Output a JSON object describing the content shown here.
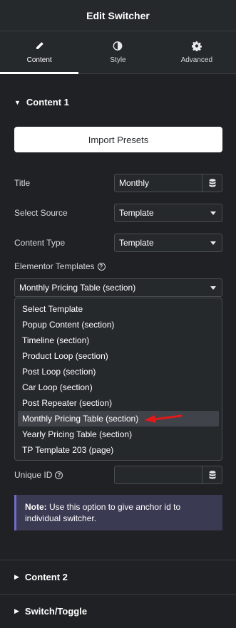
{
  "header": {
    "title": "Edit Switcher"
  },
  "tabs": [
    {
      "label": "Content",
      "icon": "pencil-icon",
      "active": true
    },
    {
      "label": "Style",
      "icon": "half-circle-icon",
      "active": false
    },
    {
      "label": "Advanced",
      "icon": "gear-icon",
      "active": false
    }
  ],
  "section1": {
    "title": "Content 1",
    "import_label": "Import Presets",
    "title_field": {
      "label": "Title",
      "value": "Monthly"
    },
    "select_source": {
      "label": "Select Source",
      "value": "Template"
    },
    "content_type": {
      "label": "Content Type",
      "value": "Template"
    },
    "elementor_templates": {
      "label": "Elementor Templates",
      "value": "Monthly Pricing Table (section)",
      "options": [
        "Select Template",
        "Popup Content (section)",
        "Timeline (section)",
        "Product Loop (section)",
        "Post Loop (section)",
        "Car Loop (section)",
        "Post Repeater (section)",
        "Monthly Pricing Table (section)",
        "Yearly Pricing Table (section)",
        "TP Template 203 (page)"
      ],
      "highlighted_index": 7
    },
    "unique_id": {
      "label": "Unique ID",
      "value": ""
    },
    "note": {
      "bold": "Note:",
      "text": " Use this option to give anchor id to individual switcher."
    }
  },
  "section2": {
    "title": "Content 2"
  },
  "section3": {
    "title": "Switch/Toggle"
  },
  "colors": {
    "panel_bg": "#26292c",
    "body_bg": "#1f2124",
    "note_bg": "#3a3a53",
    "note_border": "#6e6dc8",
    "arrow": "#e0191b"
  }
}
